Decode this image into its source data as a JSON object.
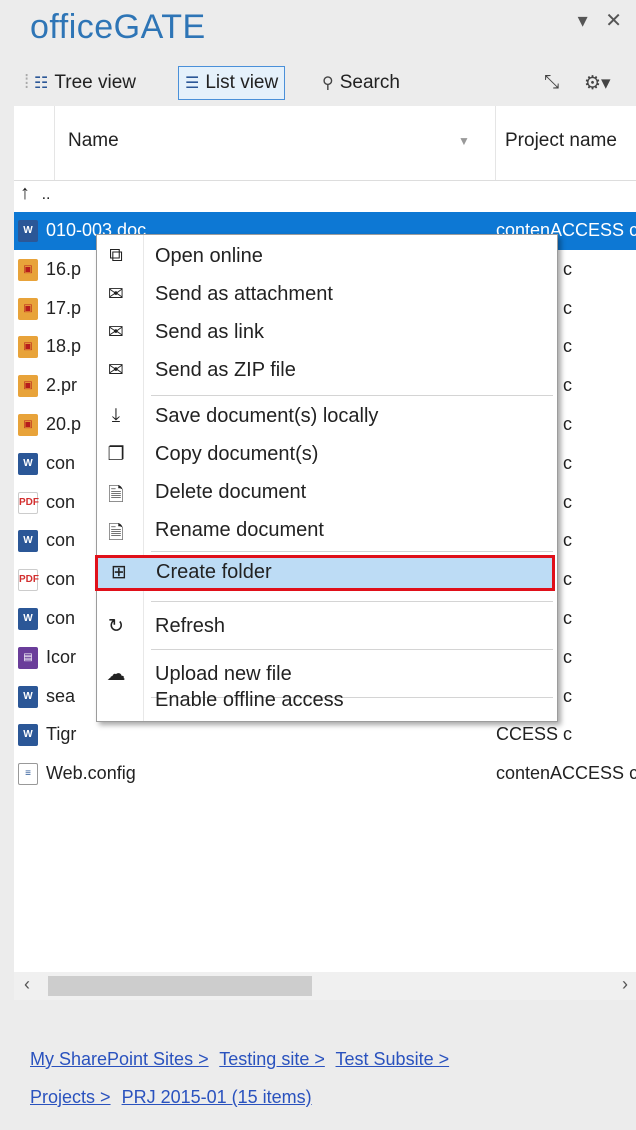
{
  "pane": {
    "title": "officeGATE",
    "dropdown_glyph": "▾",
    "close_glyph": "✕"
  },
  "toolbar": {
    "tree_view": "Tree view",
    "list_view": "List view",
    "search": "Search",
    "icons": [
      "tree-view-icon",
      "list-view-icon",
      "magnifier-icon",
      "collapse-arrows-icon",
      "gear-icon"
    ]
  },
  "list": {
    "columns": {
      "name": "Name",
      "project": "Project name"
    },
    "up_label": "..",
    "rows": [
      {
        "type": "word",
        "name": "010-003.doc",
        "project": "contenACCESS c",
        "selected": true
      },
      {
        "type": "img",
        "name": "16.p",
        "project": "CCESS c"
      },
      {
        "type": "img",
        "name": "17.p",
        "project": "CCESS c"
      },
      {
        "type": "img",
        "name": "18.p",
        "project": "CCESS c"
      },
      {
        "type": "img",
        "name": "2.pr",
        "project": "CCESS c"
      },
      {
        "type": "img",
        "name": "20.p",
        "project": "CCESS c"
      },
      {
        "type": "word",
        "name": "con",
        "project": "CCESS c"
      },
      {
        "type": "pdf",
        "name": "con",
        "project": "CCESS c"
      },
      {
        "type": "word",
        "name": "con",
        "project": "CCESS c"
      },
      {
        "type": "pdf",
        "name": "con",
        "project": "CCESS c"
      },
      {
        "type": "word",
        "name": "con",
        "project": "CCESS c"
      },
      {
        "type": "zip",
        "name": "Icor",
        "project": "CCESS c"
      },
      {
        "type": "word",
        "name": "sea",
        "project": "CCESS c"
      },
      {
        "type": "word",
        "name": "Tigr",
        "project": "CCESS c"
      },
      {
        "type": "cfg",
        "name": "Web.config",
        "project": "contenACCESS c"
      }
    ]
  },
  "context_menu": {
    "items": [
      {
        "icon": "open-external-icon",
        "glyph": "⧉",
        "label": "Open online"
      },
      {
        "icon": "mail-attachment-icon",
        "glyph": "✉",
        "label": "Send as attachment"
      },
      {
        "icon": "mail-link-icon",
        "glyph": "✉",
        "label": "Send as link"
      },
      {
        "icon": "mail-zip-icon",
        "glyph": "✉",
        "label": "Send as ZIP file"
      },
      {
        "icon": "download-icon",
        "glyph": "⤓",
        "label": "Save document(s) locally"
      },
      {
        "icon": "copy-icon",
        "glyph": "❐",
        "label": "Copy document(s)"
      },
      {
        "icon": "delete-document-icon",
        "glyph": "🗎",
        "label": "Delete document"
      },
      {
        "icon": "rename-document-icon",
        "glyph": "🗎",
        "label": "Rename document"
      },
      {
        "icon": "create-folder-icon",
        "glyph": "⊞",
        "label": "Create folder"
      },
      {
        "icon": "refresh-icon",
        "glyph": "↻",
        "label": "Refresh"
      },
      {
        "icon": "cloud-upload-icon",
        "glyph": "☁",
        "label": "Upload new file"
      },
      {
        "icon": "",
        "glyph": "",
        "label": "Enable offline access"
      }
    ],
    "highlighted": "Create folder"
  },
  "breadcrumb": {
    "items": [
      "My SharePoint Sites >",
      "Testing site >",
      "Test Subsite >",
      "Projects >",
      "PRJ 2015-01 (15 items)"
    ]
  },
  "colors": {
    "title": "#2e75b6",
    "selection": "#0d78d4",
    "menu_highlight": "#bddcf5",
    "annotation_outline": "#e0101a",
    "link": "#2a52be"
  }
}
